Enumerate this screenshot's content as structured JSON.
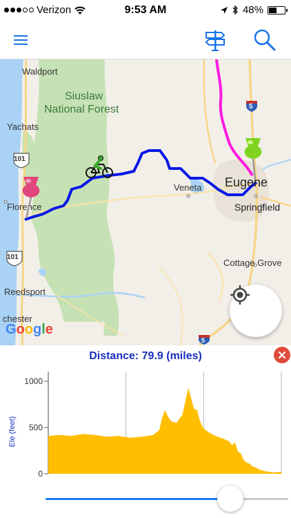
{
  "status_bar": {
    "carrier": "Verizon",
    "time": "9:53 AM",
    "battery_text": "48%",
    "battery_level": 0.48,
    "signal_bars_filled": 3,
    "signal_bars_total": 5
  },
  "nav": {
    "menu_icon": "hamburger-menu-icon",
    "signpost_icon": "signpost-icon",
    "search_icon": "search-icon",
    "accent_color": "#1a73e8"
  },
  "map": {
    "labels": {
      "waldport": "Waldport",
      "siuslaw": "Siuslaw",
      "national_forest": "National Forest",
      "yachats": "Yachats",
      "florence": "Florence",
      "veneta": "Veneta",
      "eugene": "Eugene",
      "springfield": "Springfield",
      "cottage_grove": "Cottage Grove",
      "reedsport": "Reedsport",
      "chester": "chester",
      "highway_101_a": "101",
      "highway_101_b": "101",
      "interstate_5_a": "5",
      "interstate_5_b": "5",
      "google": "Google"
    },
    "route_color": "#0a18e6",
    "alt_route_color": "#ff19e0",
    "start_pin_color": "#e0457b",
    "end_pin_color": "#7fd321"
  },
  "elevation": {
    "distance_label": "Distance: 79.9 (miles)",
    "y_axis_label": "Ele (feet)",
    "close_icon": "close-icon"
  },
  "chart_data": {
    "type": "area",
    "title": "",
    "xlabel": "",
    "ylabel": "Ele (feet)",
    "ylim": [
      0,
      1000
    ],
    "yticks": [
      0,
      500,
      1000
    ],
    "grid": true,
    "color": "#ffbe00",
    "x": [
      0,
      4,
      8,
      12,
      16,
      20,
      24,
      28,
      32,
      36,
      38,
      39,
      40,
      41,
      42,
      43,
      44,
      45,
      46,
      48,
      50,
      51,
      52,
      53,
      54,
      56,
      58,
      60,
      62,
      63,
      64,
      65,
      66,
      67,
      68,
      69,
      70,
      71,
      72,
      73,
      74,
      75,
      76,
      77,
      78,
      79,
      79.9
    ],
    "values": [
      410,
      420,
      410,
      430,
      420,
      400,
      410,
      390,
      400,
      420,
      470,
      600,
      690,
      620,
      570,
      560,
      550,
      600,
      640,
      930,
      700,
      690,
      570,
      500,
      470,
      430,
      400,
      380,
      350,
      310,
      340,
      240,
      220,
      150,
      120,
      110,
      80,
      70,
      50,
      40,
      30,
      25,
      20,
      15,
      15,
      20,
      20
    ]
  },
  "slider": {
    "value": 0.76
  }
}
